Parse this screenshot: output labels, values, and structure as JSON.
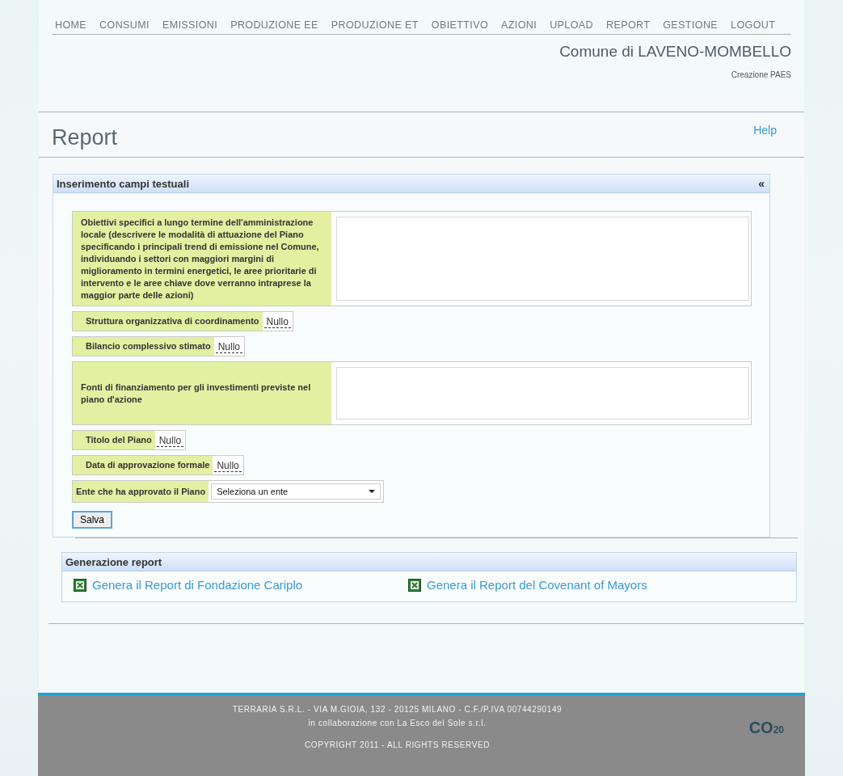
{
  "nav": [
    {
      "label": "HOME",
      "selected": false
    },
    {
      "label": "CONSUMI",
      "selected": false
    },
    {
      "label": "EMISSIONI",
      "selected": false
    },
    {
      "label": "PRODUZIONE EE",
      "selected": false
    },
    {
      "label": "PRODUZIONE ET",
      "selected": false
    },
    {
      "label": "OBIETTIVO",
      "selected": false
    },
    {
      "label": "AZIONI",
      "selected": false
    },
    {
      "label": "UPLOAD",
      "selected": false
    },
    {
      "label": "REPORT",
      "selected": false
    },
    {
      "label": "GESTIONE",
      "selected": false
    },
    {
      "label": "LOGOUT",
      "selected": false
    }
  ],
  "header": {
    "title": "Comune di LAVENO-MOMBELLO",
    "subtitle": "Creazione PAES"
  },
  "page": {
    "title": "Report",
    "help": "Help"
  },
  "form_panel": {
    "title": "Inserimento campi testuali",
    "collapse": "«",
    "fields": [
      {
        "kind": "textarea",
        "label": "Obiettivi specifici a lungo termine dell'amministrazione locale (descrivere le modalità di attuazione del Piano specificando i principali trend di emissione nel Comune, individuando i settori con maggiori margini di miglioramento in termini energetici, le aree prioritarie di intervento e le aree chiave dove verranno intraprese la maggior parte delle azioni)"
      },
      {
        "kind": "inline",
        "label": "Struttura organizzativa di coordinamento",
        "value": "Nullo"
      },
      {
        "kind": "inline",
        "label": "Bilancio complessivo stimato",
        "value": "Nullo"
      },
      {
        "kind": "textarea",
        "label": "Fonti di finanziamento per gli investimenti previste nel piano d'azione"
      },
      {
        "kind": "inline",
        "label": "Titolo del Piano",
        "value": "Nullo"
      },
      {
        "kind": "inline",
        "label": "Data di approvazione formale",
        "value": "Nullo"
      },
      {
        "kind": "select",
        "label": "Ente che ha approvato il Piano",
        "value": "Seleziona un ente"
      }
    ],
    "save": "Salva"
  },
  "report_panel": {
    "title": "Generazione report",
    "links": [
      "Genera il Report di Fondazione Cariplo",
      "Genera il Report del Covenant of Mayors"
    ]
  },
  "footer": {
    "lines": [
      "TERRARIA S.R.L. - VIA M.GIOIA, 132 - 20125 MILANO - C.F./P.IVA 00744290149",
      "in collaborazione con La Esco del Sole s.r.l.",
      "COPYRIGHT 2011 - ALL RIGHTS RESERVED"
    ],
    "logo": {
      "text": "CO",
      "sub": "20"
    }
  }
}
